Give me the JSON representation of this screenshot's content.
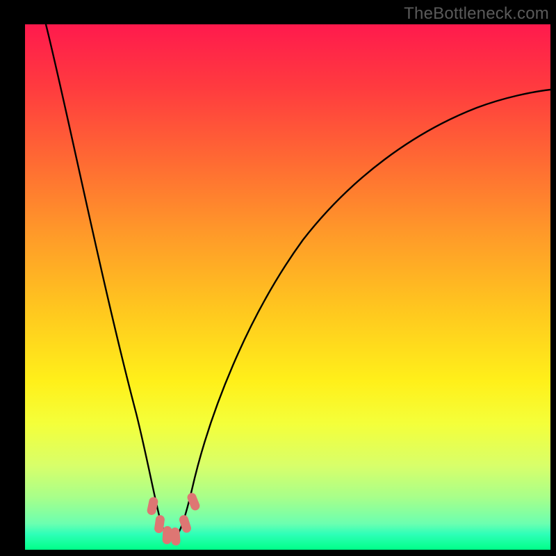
{
  "watermark": "TheBottleneck.com",
  "colors": {
    "frame": "#000000",
    "curve": "#000000",
    "marker": "#de7673"
  },
  "chart_data": {
    "type": "line",
    "title": "",
    "xlabel": "",
    "ylabel": "",
    "xlim": [
      0,
      100
    ],
    "ylim": [
      0,
      100
    ],
    "x": [
      4,
      6,
      8,
      10,
      12,
      14,
      16,
      18,
      20,
      22,
      23.5,
      25,
      26.5,
      28,
      30,
      32,
      35,
      40,
      45,
      50,
      55,
      60,
      65,
      70,
      75,
      80,
      85,
      90,
      95,
      100
    ],
    "y": [
      100,
      87,
      74,
      62,
      51,
      41,
      32,
      24,
      16,
      9,
      5,
      2.5,
      2.5,
      5,
      12,
      20,
      31,
      44,
      54,
      61,
      67,
      71,
      74.5,
      77.5,
      80,
      82,
      83.5,
      84.8,
      85.8,
      86.5
    ],
    "markers": {
      "x": [
        22.5,
        24,
        25,
        26,
        27,
        28.2,
        29.5
      ],
      "y": [
        7.5,
        4,
        3,
        2.8,
        3.5,
        6,
        10
      ]
    },
    "note": "Values estimated from pixel positions; axes have no printed ticks."
  }
}
